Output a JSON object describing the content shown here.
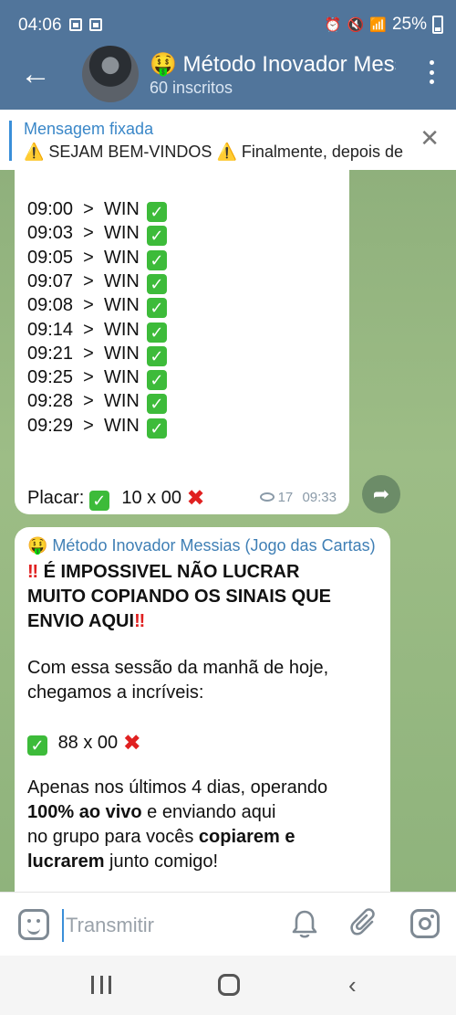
{
  "status_bar": {
    "time": "04:06",
    "battery": "25%"
  },
  "header": {
    "back_icon": "arrow-left-icon",
    "title": "🤑 Método Inovador Messias (Jogo das Cartas)",
    "subtitle": "60 inscritos",
    "menu_icon": "more-vertical-icon"
  },
  "pinned": {
    "title": "Mensagem fixada",
    "text": "⚠️ SEJAM BEM-VINDOS ⚠️  Finalmente, depois de muito tempo"
  },
  "message1": {
    "signals": [
      {
        "time": "09:00",
        "result": "WIN"
      },
      {
        "time": "09:03",
        "result": "WIN"
      },
      {
        "time": "09:05",
        "result": "WIN"
      },
      {
        "time": "09:07",
        "result": "WIN"
      },
      {
        "time": "09:08",
        "result": "WIN"
      },
      {
        "time": "09:14",
        "result": "WIN"
      },
      {
        "time": "09:21",
        "result": "WIN"
      },
      {
        "time": "09:25",
        "result": "WIN"
      },
      {
        "time": "09:28",
        "result": "WIN"
      },
      {
        "time": "09:29",
        "result": "WIN"
      }
    ],
    "placar_label": "Placar:",
    "placar_score": "10 x 00",
    "views": "17",
    "time": "09:33"
  },
  "message2": {
    "author": "🤑 Método Inovador Messias (Jogo das Cartas)",
    "headline_1": "É IMPOSSIVEL NÃO LUCRAR",
    "headline_2": "MUITO COPIANDO OS SINAIS QUE",
    "headline_3": "ENVIO AQUI",
    "line_1": "Com essa sessão da manhã de hoje,",
    "line_2": "chegamos a incríveis:",
    "score": "88 x 00",
    "p1": "Apenas nos últimos 4 dias, operando",
    "p2_bold": "100% ao vivo",
    "p2_rest": " e enviando aqui",
    "p3_pre": "no grupo para vocês ",
    "p3_bold": "copiarem e",
    "p4_bold": "lucrarem",
    "p4_rest": " junto comigo!"
  },
  "composer": {
    "placeholder": "Transmitir"
  },
  "colors": {
    "header": "#51759b",
    "link": "#3a87c8",
    "win_check": "#3dbb3a",
    "loss_cross": "#e02020"
  }
}
